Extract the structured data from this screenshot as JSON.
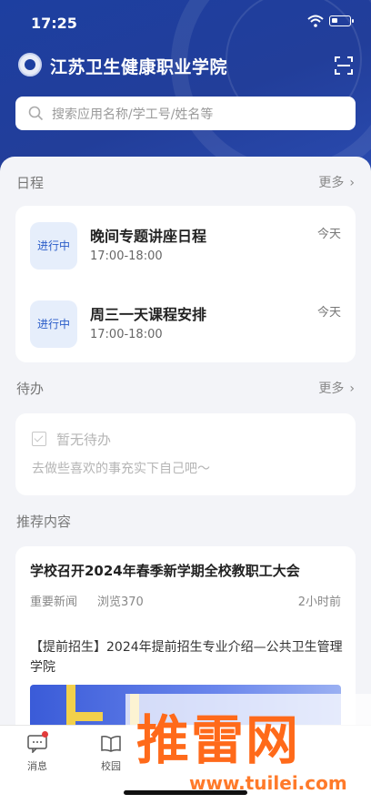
{
  "status_bar": {
    "time": "17:25"
  },
  "header": {
    "school_name": "江苏卫生健康职业学院",
    "search_placeholder": "搜索应用名称/学工号/姓名等"
  },
  "schedule": {
    "title": "日程",
    "more": "更多",
    "items": [
      {
        "badge": "进行中",
        "title": "晚间专题讲座日程",
        "time": "17:00-18:00",
        "day": "今天"
      },
      {
        "badge": "进行中",
        "title": "周三一天课程安排",
        "time": "17:00-18:00",
        "day": "今天"
      }
    ]
  },
  "todo": {
    "title": "待办",
    "more": "更多",
    "empty": "暂无待办",
    "hint": "去做些喜欢的事充实下自己吧～"
  },
  "recommend": {
    "title": "推荐内容",
    "news": [
      {
        "headline": "学校召开2024年春季新学期全校教职工大会",
        "tag": "重要新闻",
        "views": "浏览370",
        "ago": "2小时前"
      },
      {
        "headline": "【提前招生】2024年提前招生专业介绍—公共卫生管理学院"
      }
    ]
  },
  "tabbar": {
    "items": [
      {
        "label": "消息",
        "icon": "message-icon"
      },
      {
        "label": "校园",
        "icon": "book-icon"
      }
    ]
  },
  "watermark": {
    "brand": "推雷网",
    "url": "www.tuilei.com"
  }
}
